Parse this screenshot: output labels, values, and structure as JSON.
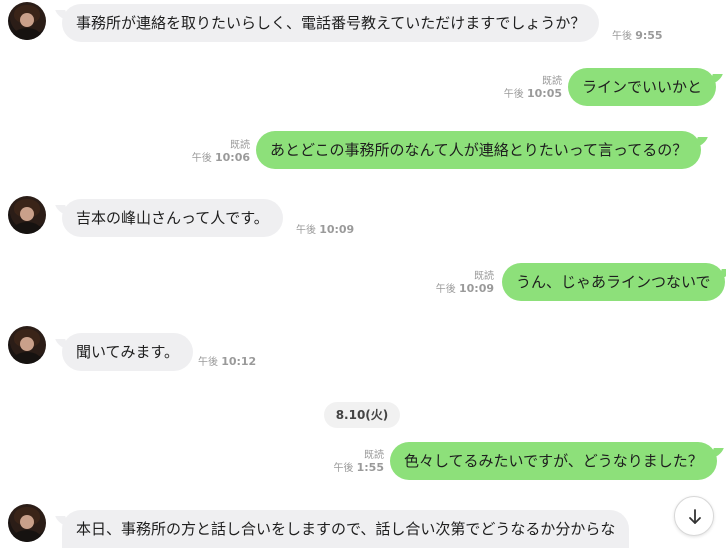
{
  "messages": [
    {
      "side": "in",
      "text": "事務所が連絡を取りたいらしく、電話番号教えていただけますでしょうか？",
      "time_label": "午後",
      "time": "9:55"
    },
    {
      "side": "out",
      "text": "ラインでいいかと",
      "read": "既読",
      "time_label": "午後",
      "time": "10:05"
    },
    {
      "side": "out",
      "text": "あとどこの事務所のなんて人が連絡とりたいって言ってるの？",
      "read": "既読",
      "time_label": "午後",
      "time": "10:06"
    },
    {
      "side": "in",
      "text": "吉本の峰山さんって人です。",
      "time_label": "午後",
      "time": "10:09"
    },
    {
      "side": "out",
      "text": "うん、じゃあラインつないで",
      "read": "既読",
      "time_label": "午後",
      "time": "10:09"
    },
    {
      "side": "in",
      "text": "聞いてみます。",
      "time_label": "午後",
      "time": "10:12"
    },
    {
      "side": "out",
      "text": "色々してるみたいですが、どうなりました？",
      "read": "既読",
      "time_label": "午後",
      "time": "1:55"
    },
    {
      "side": "in",
      "text": "本日、事務所の方と話し合いをしますので、話し合い次第でどうなるか分からな"
    }
  ],
  "date_separator": "8.10(火)",
  "scroll_button": {
    "icon": "arrow-down-icon"
  },
  "colors": {
    "outgoing_bubble": "#8de07a",
    "incoming_bubble": "#efeff1",
    "meta_text": "#9a9a9a"
  }
}
